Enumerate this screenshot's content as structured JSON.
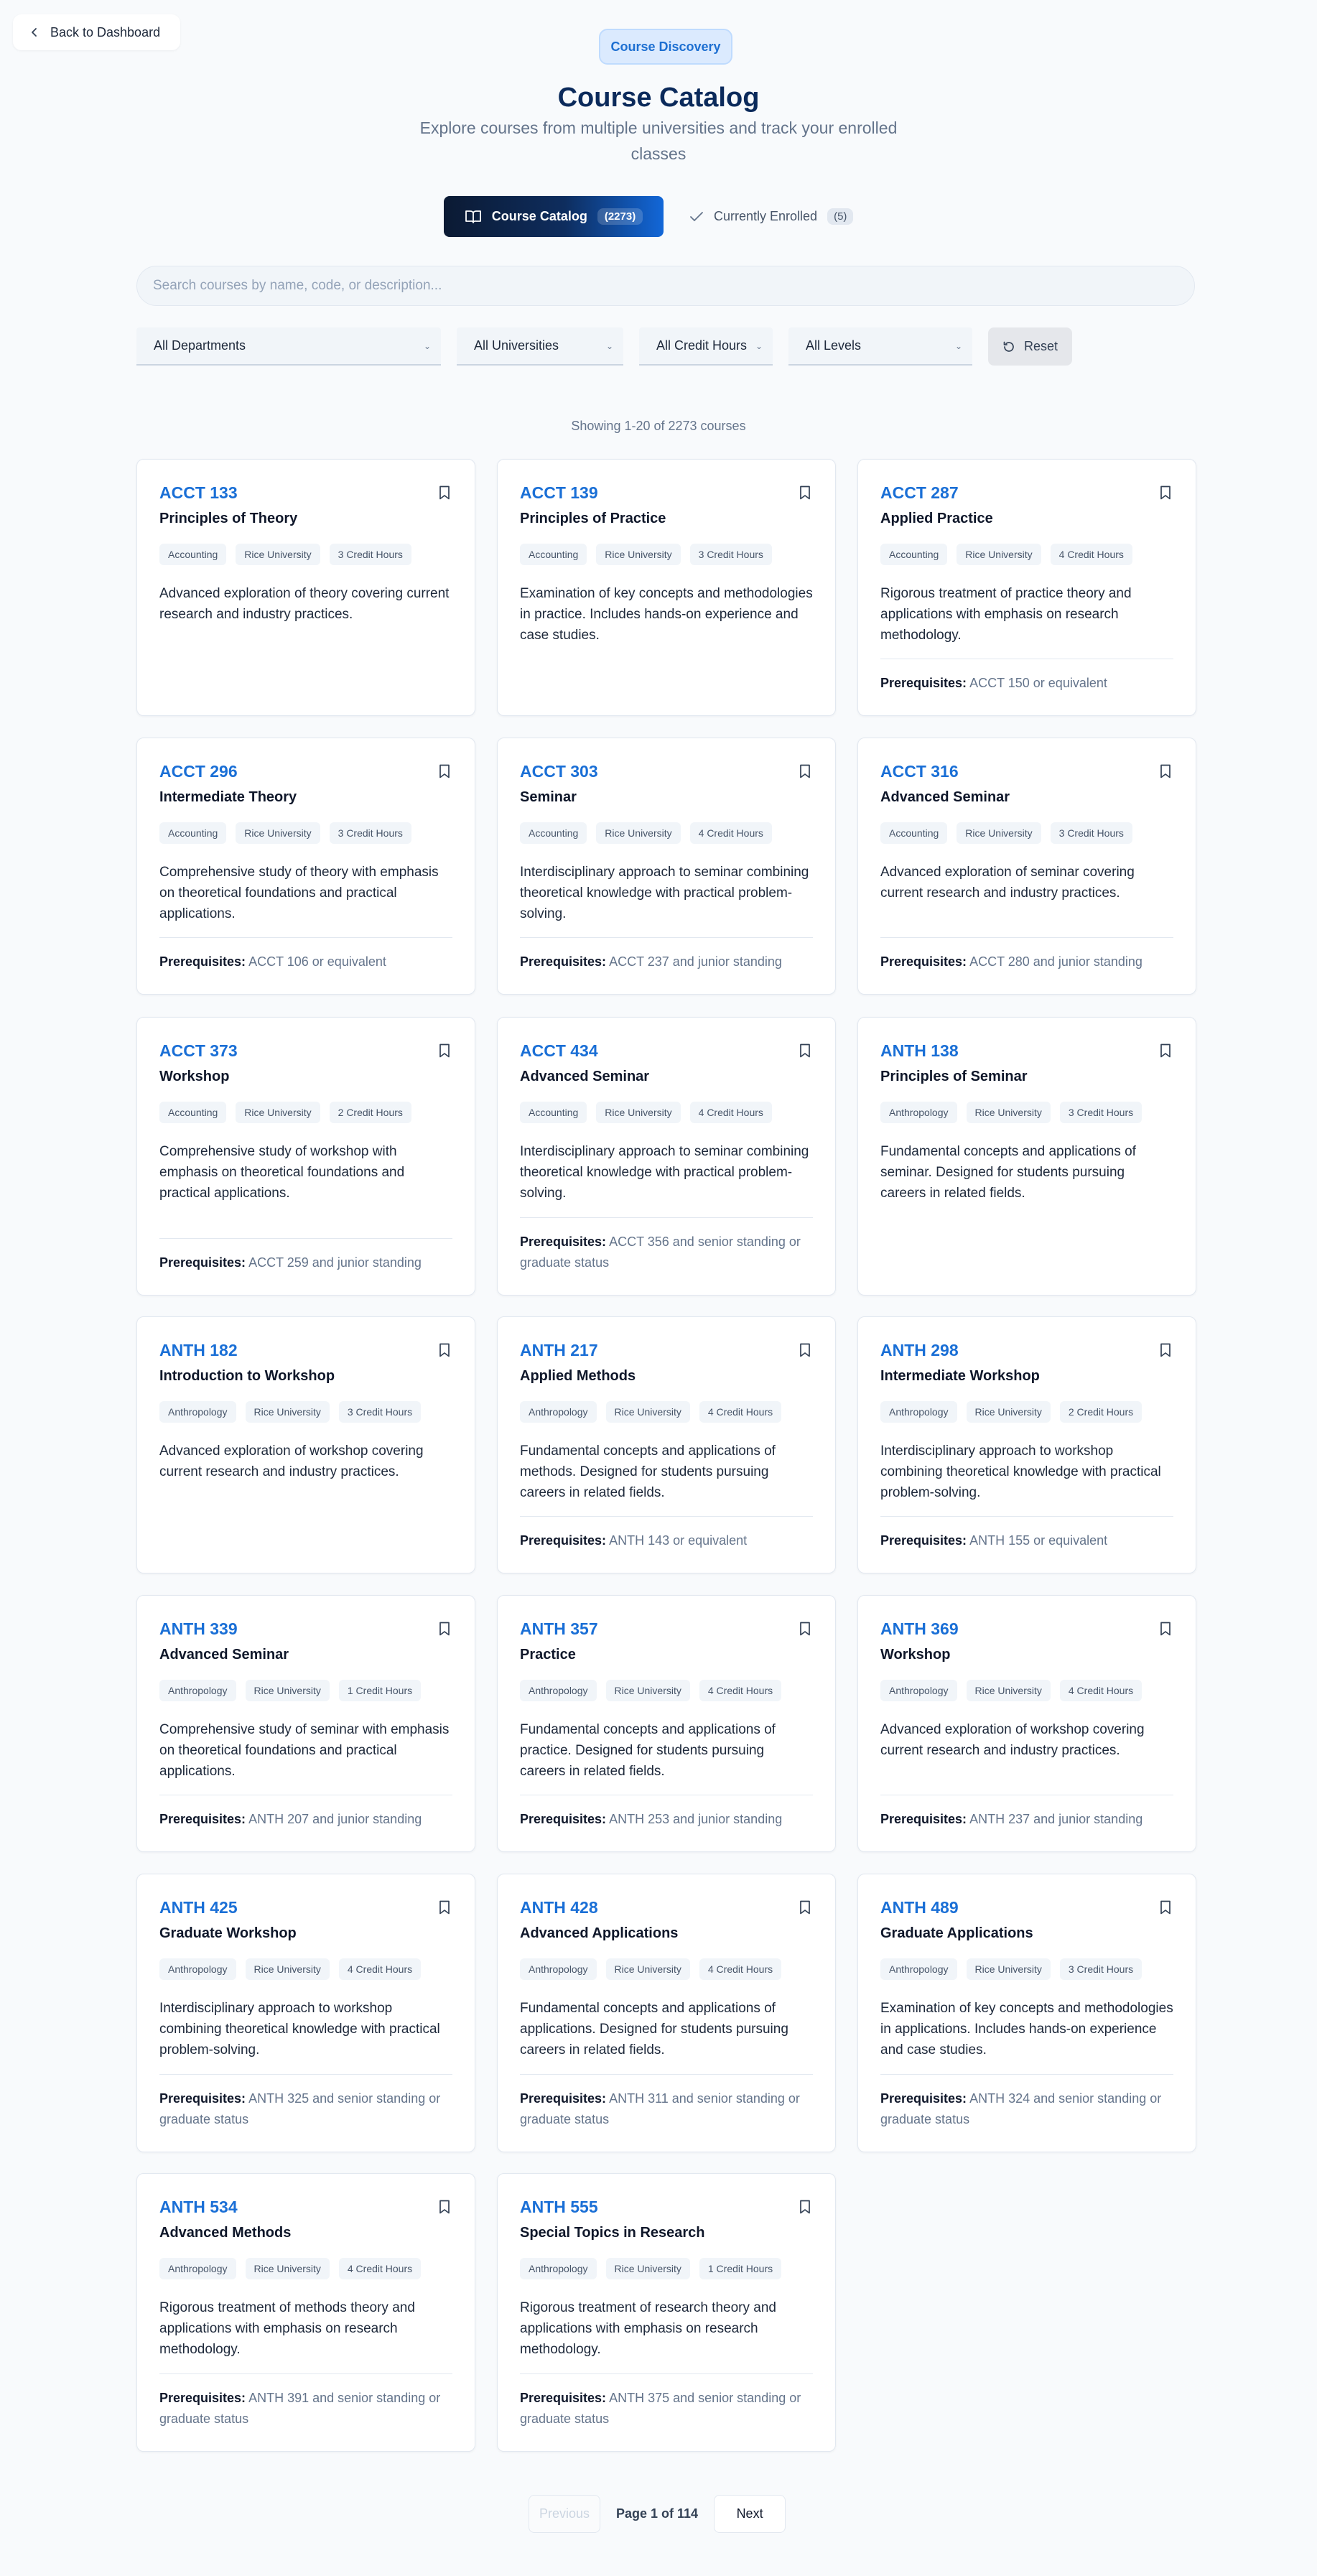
{
  "header": {
    "back_label": "Back to Dashboard",
    "badge": "Course Discovery",
    "title": "Course Catalog",
    "subtitle": "Explore courses from multiple universities and track your enrolled classes"
  },
  "tabs": {
    "catalog_label": "Course Catalog",
    "catalog_count": "2273",
    "enrolled_label": "Currently Enrolled",
    "enrolled_count": "5"
  },
  "search": {
    "placeholder": "Search courses by name, code, or description..."
  },
  "filters": {
    "department": "All Departments",
    "university": "All Universities",
    "credit_hours": "All Credit Hours",
    "level": "All Levels",
    "reset_label": "Reset"
  },
  "showing": "Showing 1-20 of 2273 courses",
  "prereq_label": "Prerequisites:",
  "courses": [
    {
      "code": "ACCT 133",
      "title": "Principles of Theory",
      "dept": "Accounting",
      "uni": "Rice University",
      "credits": "3 Credit Hours",
      "desc": "Advanced exploration of theory covering current research and industry practices.",
      "prereq": ""
    },
    {
      "code": "ACCT 139",
      "title": "Principles of Practice",
      "dept": "Accounting",
      "uni": "Rice University",
      "credits": "3 Credit Hours",
      "desc": "Examination of key concepts and methodologies in practice. Includes hands-on experience and case studies.",
      "prereq": ""
    },
    {
      "code": "ACCT 287",
      "title": "Applied Practice",
      "dept": "Accounting",
      "uni": "Rice University",
      "credits": "4 Credit Hours",
      "desc": "Rigorous treatment of practice theory and applications with emphasis on research methodology.",
      "prereq": "ACCT 150 or equivalent"
    },
    {
      "code": "ACCT 296",
      "title": "Intermediate Theory",
      "dept": "Accounting",
      "uni": "Rice University",
      "credits": "3 Credit Hours",
      "desc": "Comprehensive study of theory with emphasis on theoretical foundations and practical applications.",
      "prereq": "ACCT 106 or equivalent"
    },
    {
      "code": "ACCT 303",
      "title": "Seminar",
      "dept": "Accounting",
      "uni": "Rice University",
      "credits": "4 Credit Hours",
      "desc": "Interdisciplinary approach to seminar combining theoretical knowledge with practical problem-solving.",
      "prereq": "ACCT 237 and junior standing"
    },
    {
      "code": "ACCT 316",
      "title": "Advanced Seminar",
      "dept": "Accounting",
      "uni": "Rice University",
      "credits": "3 Credit Hours",
      "desc": "Advanced exploration of seminar covering current research and industry practices.",
      "prereq": "ACCT 280 and junior standing"
    },
    {
      "code": "ACCT 373",
      "title": "Workshop",
      "dept": "Accounting",
      "uni": "Rice University",
      "credits": "2 Credit Hours",
      "desc": "Comprehensive study of workshop with emphasis on theoretical foundations and practical applications.",
      "prereq": "ACCT 259 and junior standing"
    },
    {
      "code": "ACCT 434",
      "title": "Advanced Seminar",
      "dept": "Accounting",
      "uni": "Rice University",
      "credits": "4 Credit Hours",
      "desc": "Interdisciplinary approach to seminar combining theoretical knowledge with practical problem-solving.",
      "prereq": "ACCT 356 and senior standing or graduate status"
    },
    {
      "code": "ANTH 138",
      "title": "Principles of Seminar",
      "dept": "Anthropology",
      "uni": "Rice University",
      "credits": "3 Credit Hours",
      "desc": "Fundamental concepts and applications of seminar. Designed for students pursuing careers in related fields.",
      "prereq": ""
    },
    {
      "code": "ANTH 182",
      "title": "Introduction to Workshop",
      "dept": "Anthropology",
      "uni": "Rice University",
      "credits": "3 Credit Hours",
      "desc": "Advanced exploration of workshop covering current research and industry practices.",
      "prereq": ""
    },
    {
      "code": "ANTH 217",
      "title": "Applied Methods",
      "dept": "Anthropology",
      "uni": "Rice University",
      "credits": "4 Credit Hours",
      "desc": "Fundamental concepts and applications of methods. Designed for students pursuing careers in related fields.",
      "prereq": "ANTH 143 or equivalent"
    },
    {
      "code": "ANTH 298",
      "title": "Intermediate Workshop",
      "dept": "Anthropology",
      "uni": "Rice University",
      "credits": "2 Credit Hours",
      "desc": "Interdisciplinary approach to workshop combining theoretical knowledge with practical problem-solving.",
      "prereq": "ANTH 155 or equivalent"
    },
    {
      "code": "ANTH 339",
      "title": "Advanced Seminar",
      "dept": "Anthropology",
      "uni": "Rice University",
      "credits": "1 Credit Hours",
      "desc": "Comprehensive study of seminar with emphasis on theoretical foundations and practical applications.",
      "prereq": "ANTH 207 and junior standing"
    },
    {
      "code": "ANTH 357",
      "title": "Practice",
      "dept": "Anthropology",
      "uni": "Rice University",
      "credits": "4 Credit Hours",
      "desc": "Fundamental concepts and applications of practice. Designed for students pursuing careers in related fields.",
      "prereq": "ANTH 253 and junior standing"
    },
    {
      "code": "ANTH 369",
      "title": "Workshop",
      "dept": "Anthropology",
      "uni": "Rice University",
      "credits": "4 Credit Hours",
      "desc": "Advanced exploration of workshop covering current research and industry practices.",
      "prereq": "ANTH 237 and junior standing"
    },
    {
      "code": "ANTH 425",
      "title": "Graduate Workshop",
      "dept": "Anthropology",
      "uni": "Rice University",
      "credits": "4 Credit Hours",
      "desc": "Interdisciplinary approach to workshop combining theoretical knowledge with practical problem-solving.",
      "prereq": "ANTH 325 and senior standing or graduate status"
    },
    {
      "code": "ANTH 428",
      "title": "Advanced Applications",
      "dept": "Anthropology",
      "uni": "Rice University",
      "credits": "4 Credit Hours",
      "desc": "Fundamental concepts and applications of applications. Designed for students pursuing careers in related fields.",
      "prereq": "ANTH 311 and senior standing or graduate status"
    },
    {
      "code": "ANTH 489",
      "title": "Graduate Applications",
      "dept": "Anthropology",
      "uni": "Rice University",
      "credits": "3 Credit Hours",
      "desc": "Examination of key concepts and methodologies in applications. Includes hands-on experience and case studies.",
      "prereq": "ANTH 324 and senior standing or graduate status"
    },
    {
      "code": "ANTH 534",
      "title": "Advanced Methods",
      "dept": "Anthropology",
      "uni": "Rice University",
      "credits": "4 Credit Hours",
      "desc": "Rigorous treatment of methods theory and applications with emphasis on research methodology.",
      "prereq": "ANTH 391 and senior standing or graduate status"
    },
    {
      "code": "ANTH 555",
      "title": "Special Topics in Research",
      "dept": "Anthropology",
      "uni": "Rice University",
      "credits": "1 Credit Hours",
      "desc": "Rigorous treatment of research theory and applications with emphasis on research methodology.",
      "prereq": "ANTH 375 and senior standing or graduate status"
    }
  ],
  "pagination": {
    "previous_label": "Previous",
    "page_label": "Page 1 of 114",
    "next_label": "Next"
  }
}
